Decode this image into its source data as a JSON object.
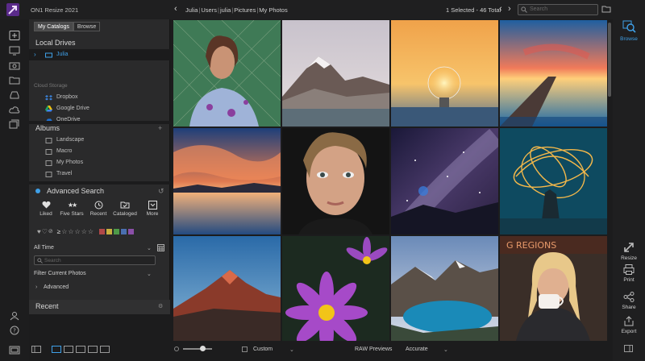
{
  "app": {
    "title": "ON1 Resize 2021",
    "accent": "#3fa0e8"
  },
  "breadcrumb": [
    "Julia",
    "Users",
    "julia",
    "Pictures",
    "My Photos"
  ],
  "selection": {
    "text": "1 Selected - 46 Total"
  },
  "search": {
    "placeholder": "Search"
  },
  "panel": {
    "tabs": [
      {
        "label": "My Catalogs"
      },
      {
        "label": "Browse"
      }
    ],
    "local_drives": {
      "title": "Local Drives",
      "items": [
        {
          "label": "Julia"
        }
      ]
    },
    "cloud_storage": {
      "title": "Cloud Storage",
      "items": [
        {
          "label": "Dropbox"
        },
        {
          "label": "Google Drive"
        },
        {
          "label": "OneDrive"
        }
      ]
    },
    "albums": {
      "title": "Albums",
      "items": [
        {
          "label": "Landscape"
        },
        {
          "label": "Macro"
        },
        {
          "label": "My Photos"
        },
        {
          "label": "Travel"
        }
      ]
    },
    "advanced_search": {
      "title": "Advanced Search",
      "quick": [
        {
          "label": "Liked"
        },
        {
          "label": "Five Stars"
        },
        {
          "label": "Recent"
        },
        {
          "label": "Cataloged"
        },
        {
          "label": "More"
        }
      ],
      "rating_prefix": "≥",
      "color_labels": [
        "#b04848",
        "#c9b040",
        "#4e9a48",
        "#4a6fb0",
        "#8a4fa8"
      ],
      "time_filter": "All Time",
      "search_placeholder": "Search",
      "filter_label": "Filter Current Photos",
      "advanced_label": "Advanced"
    },
    "recent": {
      "title": "Recent"
    }
  },
  "right_rail": {
    "browse": "Browse",
    "resize": "Resize",
    "print": "Print",
    "share": "Share",
    "export": "Export"
  },
  "bottom": {
    "mode": "Custom",
    "raw_label": "RAW Previews",
    "raw_value": "Accurate"
  }
}
